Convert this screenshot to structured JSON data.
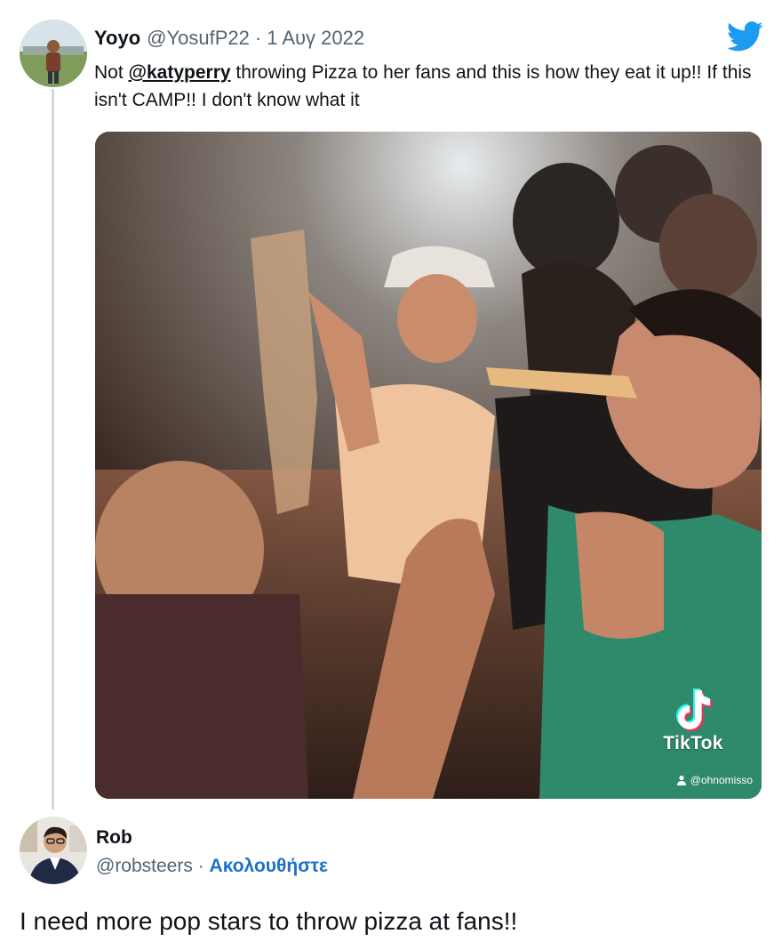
{
  "quoted_tweet": {
    "display_name": "Yoyo",
    "handle": "@YosufP22",
    "separator": "·",
    "date": "1 Αυγ 2022",
    "text_prefix": "Not ",
    "mention": "@katyperry",
    "text_suffix": " throwing Pizza to her fans and this is how they eat it up!! If this isn't CAMP!! I don't know what it",
    "logo_icon": "twitter-bird-icon",
    "brand_color": "#1d9bf0",
    "media": {
      "watermark_label": "TikTok",
      "watermark_handle": "@ohnomisso",
      "watermark_icon": "tiktok-note-icon"
    }
  },
  "reply": {
    "display_name": "Rob",
    "handle": "@robsteers",
    "separator": "·",
    "follow_label": "Ακολουθήστε",
    "text": "I need more pop stars to throw pizza at fans!!",
    "follow_color": "#1d70c9"
  }
}
